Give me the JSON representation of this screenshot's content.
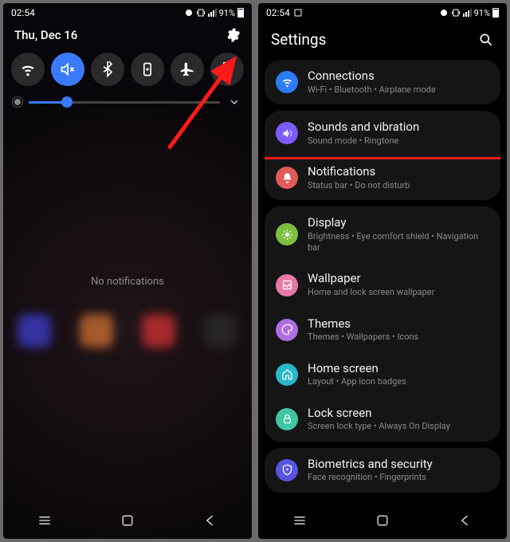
{
  "left": {
    "status": {
      "time": "02:54",
      "battery_pct": "91%"
    },
    "date": "Thu, Dec 16",
    "toggles": [
      {
        "name": "wifi",
        "active": false
      },
      {
        "name": "sound-mute",
        "active": true
      },
      {
        "name": "bluetooth",
        "active": false
      },
      {
        "name": "portrait-lock",
        "active": false
      },
      {
        "name": "airplane",
        "active": false
      },
      {
        "name": "flashlight",
        "active": false
      }
    ],
    "brightness": {
      "value_pct": 20
    },
    "no_notifications_text": "No notifications"
  },
  "right": {
    "status": {
      "time": "02:54",
      "battery_pct": "91%"
    },
    "title": "Settings",
    "groups": [
      [
        {
          "icon": "wifi",
          "color": "#2d7cf6",
          "title": "Connections",
          "sub": "Wi-Fi  •  Bluetooth  •  Airplane mode"
        }
      ],
      [
        {
          "icon": "sound",
          "color": "#7c5cff",
          "title": "Sounds and vibration",
          "sub": "Sound mode  •  Ringtone",
          "highlight": true
        },
        {
          "icon": "bell",
          "color": "#e05a5a",
          "title": "Notifications",
          "sub": "Status bar  •  Do not disturb"
        }
      ],
      [
        {
          "icon": "display",
          "color": "#7fbf3f",
          "title": "Display",
          "sub": "Brightness  •  Eye comfort shield  •  Navigation bar"
        },
        {
          "icon": "wallpaper",
          "color": "#e879a6",
          "title": "Wallpaper",
          "sub": "Home and lock screen wallpaper"
        },
        {
          "icon": "themes",
          "color": "#b06de0",
          "title": "Themes",
          "sub": "Themes  •  Wallpapers  •  Icons"
        },
        {
          "icon": "home",
          "color": "#29b8c8",
          "title": "Home screen",
          "sub": "Layout  •  App icon badges"
        },
        {
          "icon": "lock",
          "color": "#3fc6a3",
          "title": "Lock screen",
          "sub": "Screen lock type  •  Always On Display"
        }
      ],
      [
        {
          "icon": "shield",
          "color": "#5b54e0",
          "title": "Biometrics and security",
          "sub": "Face recognition  •  Fingerprints"
        }
      ]
    ]
  }
}
